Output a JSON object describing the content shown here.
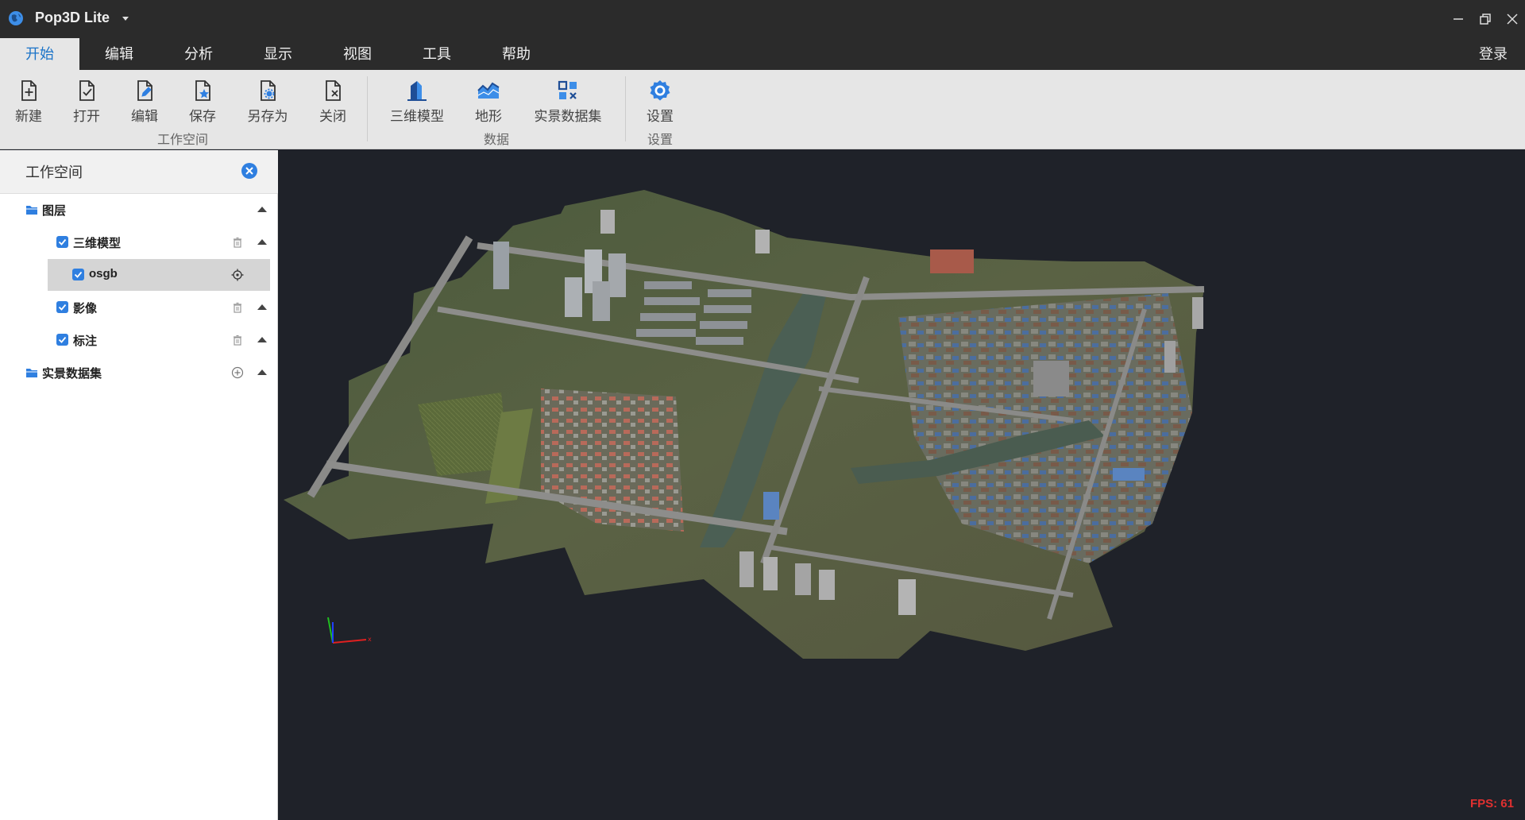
{
  "app": {
    "title": "Pop3D Lite"
  },
  "menu": {
    "tabs": [
      "开始",
      "编辑",
      "分析",
      "显示",
      "视图",
      "工具",
      "帮助"
    ],
    "active_tab": "开始",
    "login": "登录"
  },
  "ribbon": {
    "workspace": {
      "label": "工作空间",
      "buttons": [
        "新建",
        "打开",
        "编辑",
        "保存",
        "另存为",
        "关闭"
      ]
    },
    "data": {
      "label": "数据",
      "buttons": [
        "三维模型",
        "地形",
        "实景数据集"
      ]
    },
    "settings": {
      "label": "设置",
      "buttons": [
        "设置"
      ]
    }
  },
  "sidebar": {
    "title": "工作空间",
    "tree": {
      "layers": "图层",
      "model3d": "三维模型",
      "osgb": "osgb",
      "imagery": "影像",
      "annotation": "标注",
      "reality_datasets": "实景数据集"
    }
  },
  "viewport": {
    "fps_text": "FPS: 61"
  },
  "colors": {
    "accent": "#1a73c8",
    "checkbox": "#2f7fe0",
    "titlebar": "#2b2b2b",
    "ribbon": "#e6e6e6",
    "viewport_bg": "#1f2229",
    "fps": "#e03030"
  }
}
